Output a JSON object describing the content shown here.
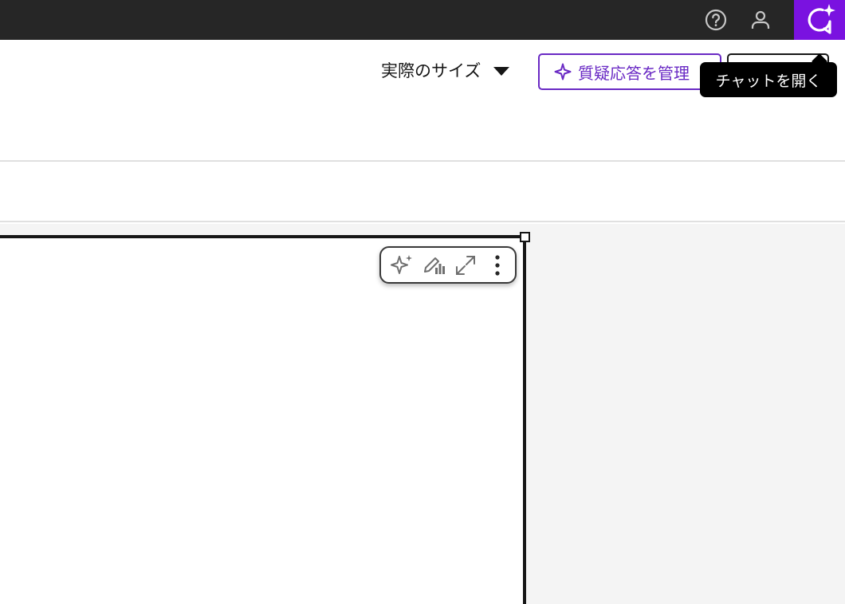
{
  "topbar": {
    "icons": [
      "help-icon",
      "user-icon",
      "ai-chat-icon"
    ],
    "chat_accent": "#7a12e0"
  },
  "toolbar": {
    "size_select": {
      "value": "実際のサイズ"
    },
    "qa_button": {
      "label": "質疑応答を管理"
    },
    "tooltip": "チャットを開く"
  },
  "widget_toolbar": {
    "icons": [
      "ai-sparkle-icon",
      "edit-chart-icon",
      "expand-icon",
      "overflow-menu-icon"
    ]
  },
  "colors": {
    "topbar_bg": "#262626",
    "accent": "#6929c4",
    "chat_bg": "#7a12e0",
    "canvas_bg": "#f4f4f4"
  }
}
